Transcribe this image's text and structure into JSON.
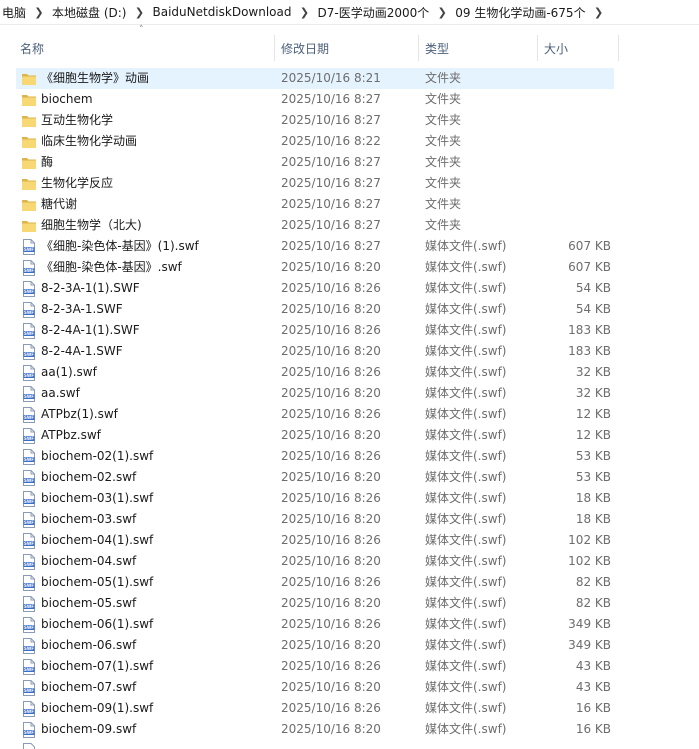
{
  "breadcrumb": [
    "电脑",
    "本地磁盘 (D:)",
    "BaiduNetdiskDownload",
    "D7-医学动画2000个",
    "09 生物化学动画-675个"
  ],
  "columns": {
    "name": "名称",
    "modified": "修改日期",
    "type": "类型",
    "size": "大小"
  },
  "colors": {
    "header_text": "#4c607a",
    "selection": "#e5f3ff",
    "folder": "#f8d775",
    "swf_icon": "#3b6ec8"
  },
  "files": [
    {
      "name": "《细胞生物学》动画",
      "modified": "2025/10/16 8:21",
      "type": "文件夹",
      "size": "",
      "icon": "folder-icon",
      "selected": true
    },
    {
      "name": "biochem",
      "modified": "2025/10/16 8:27",
      "type": "文件夹",
      "size": "",
      "icon": "folder-icon"
    },
    {
      "name": "互动生物化学",
      "modified": "2025/10/16 8:27",
      "type": "文件夹",
      "size": "",
      "icon": "folder-icon"
    },
    {
      "name": "临床生物化学动画",
      "modified": "2025/10/16 8:22",
      "type": "文件夹",
      "size": "",
      "icon": "folder-icon"
    },
    {
      "name": "酶",
      "modified": "2025/10/16 8:27",
      "type": "文件夹",
      "size": "",
      "icon": "folder-icon"
    },
    {
      "name": "生物化学反应",
      "modified": "2025/10/16 8:27",
      "type": "文件夹",
      "size": "",
      "icon": "folder-icon"
    },
    {
      "name": "糖代谢",
      "modified": "2025/10/16 8:27",
      "type": "文件夹",
      "size": "",
      "icon": "folder-icon"
    },
    {
      "name": "细胞生物学（北大)",
      "modified": "2025/10/16 8:27",
      "type": "文件夹",
      "size": "",
      "icon": "folder-icon"
    },
    {
      "name": "《细胞-染色体-基因》(1).swf",
      "modified": "2025/10/16 8:27",
      "type": "媒体文件(.swf)",
      "size": "607 KB",
      "icon": "swf-file-icon"
    },
    {
      "name": "《细胞-染色体-基因》.swf",
      "modified": "2025/10/16 8:20",
      "type": "媒体文件(.swf)",
      "size": "607 KB",
      "icon": "swf-file-icon"
    },
    {
      "name": "8-2-3A-1(1).SWF",
      "modified": "2025/10/16 8:26",
      "type": "媒体文件(.swf)",
      "size": "54 KB",
      "icon": "swf-file-icon"
    },
    {
      "name": "8-2-3A-1.SWF",
      "modified": "2025/10/16 8:20",
      "type": "媒体文件(.swf)",
      "size": "54 KB",
      "icon": "swf-file-icon"
    },
    {
      "name": "8-2-4A-1(1).SWF",
      "modified": "2025/10/16 8:26",
      "type": "媒体文件(.swf)",
      "size": "183 KB",
      "icon": "swf-file-icon"
    },
    {
      "name": "8-2-4A-1.SWF",
      "modified": "2025/10/16 8:20",
      "type": "媒体文件(.swf)",
      "size": "183 KB",
      "icon": "swf-file-icon"
    },
    {
      "name": "aa(1).swf",
      "modified": "2025/10/16 8:26",
      "type": "媒体文件(.swf)",
      "size": "32 KB",
      "icon": "swf-file-icon"
    },
    {
      "name": "aa.swf",
      "modified": "2025/10/16 8:20",
      "type": "媒体文件(.swf)",
      "size": "32 KB",
      "icon": "swf-file-icon"
    },
    {
      "name": "ATPbz(1).swf",
      "modified": "2025/10/16 8:26",
      "type": "媒体文件(.swf)",
      "size": "12 KB",
      "icon": "swf-file-icon"
    },
    {
      "name": "ATPbz.swf",
      "modified": "2025/10/16 8:20",
      "type": "媒体文件(.swf)",
      "size": "12 KB",
      "icon": "swf-file-icon"
    },
    {
      "name": "biochem-02(1).swf",
      "modified": "2025/10/16 8:26",
      "type": "媒体文件(.swf)",
      "size": "53 KB",
      "icon": "swf-file-icon"
    },
    {
      "name": "biochem-02.swf",
      "modified": "2025/10/16 8:20",
      "type": "媒体文件(.swf)",
      "size": "53 KB",
      "icon": "swf-file-icon"
    },
    {
      "name": "biochem-03(1).swf",
      "modified": "2025/10/16 8:26",
      "type": "媒体文件(.swf)",
      "size": "18 KB",
      "icon": "swf-file-icon"
    },
    {
      "name": "biochem-03.swf",
      "modified": "2025/10/16 8:20",
      "type": "媒体文件(.swf)",
      "size": "18 KB",
      "icon": "swf-file-icon"
    },
    {
      "name": "biochem-04(1).swf",
      "modified": "2025/10/16 8:26",
      "type": "媒体文件(.swf)",
      "size": "102 KB",
      "icon": "swf-file-icon"
    },
    {
      "name": "biochem-04.swf",
      "modified": "2025/10/16 8:20",
      "type": "媒体文件(.swf)",
      "size": "102 KB",
      "icon": "swf-file-icon"
    },
    {
      "name": "biochem-05(1).swf",
      "modified": "2025/10/16 8:26",
      "type": "媒体文件(.swf)",
      "size": "82 KB",
      "icon": "swf-file-icon"
    },
    {
      "name": "biochem-05.swf",
      "modified": "2025/10/16 8:20",
      "type": "媒体文件(.swf)",
      "size": "82 KB",
      "icon": "swf-file-icon"
    },
    {
      "name": "biochem-06(1).swf",
      "modified": "2025/10/16 8:26",
      "type": "媒体文件(.swf)",
      "size": "349 KB",
      "icon": "swf-file-icon"
    },
    {
      "name": "biochem-06.swf",
      "modified": "2025/10/16 8:20",
      "type": "媒体文件(.swf)",
      "size": "349 KB",
      "icon": "swf-file-icon"
    },
    {
      "name": "biochem-07(1).swf",
      "modified": "2025/10/16 8:26",
      "type": "媒体文件(.swf)",
      "size": "43 KB",
      "icon": "swf-file-icon"
    },
    {
      "name": "biochem-07.swf",
      "modified": "2025/10/16 8:20",
      "type": "媒体文件(.swf)",
      "size": "43 KB",
      "icon": "swf-file-icon"
    },
    {
      "name": "biochem-09(1).swf",
      "modified": "2025/10/16 8:26",
      "type": "媒体文件(.swf)",
      "size": "16 KB",
      "icon": "swf-file-icon"
    },
    {
      "name": "biochem-09.swf",
      "modified": "2025/10/16 8:20",
      "type": "媒体文件(.swf)",
      "size": "16 KB",
      "icon": "swf-file-icon"
    }
  ]
}
